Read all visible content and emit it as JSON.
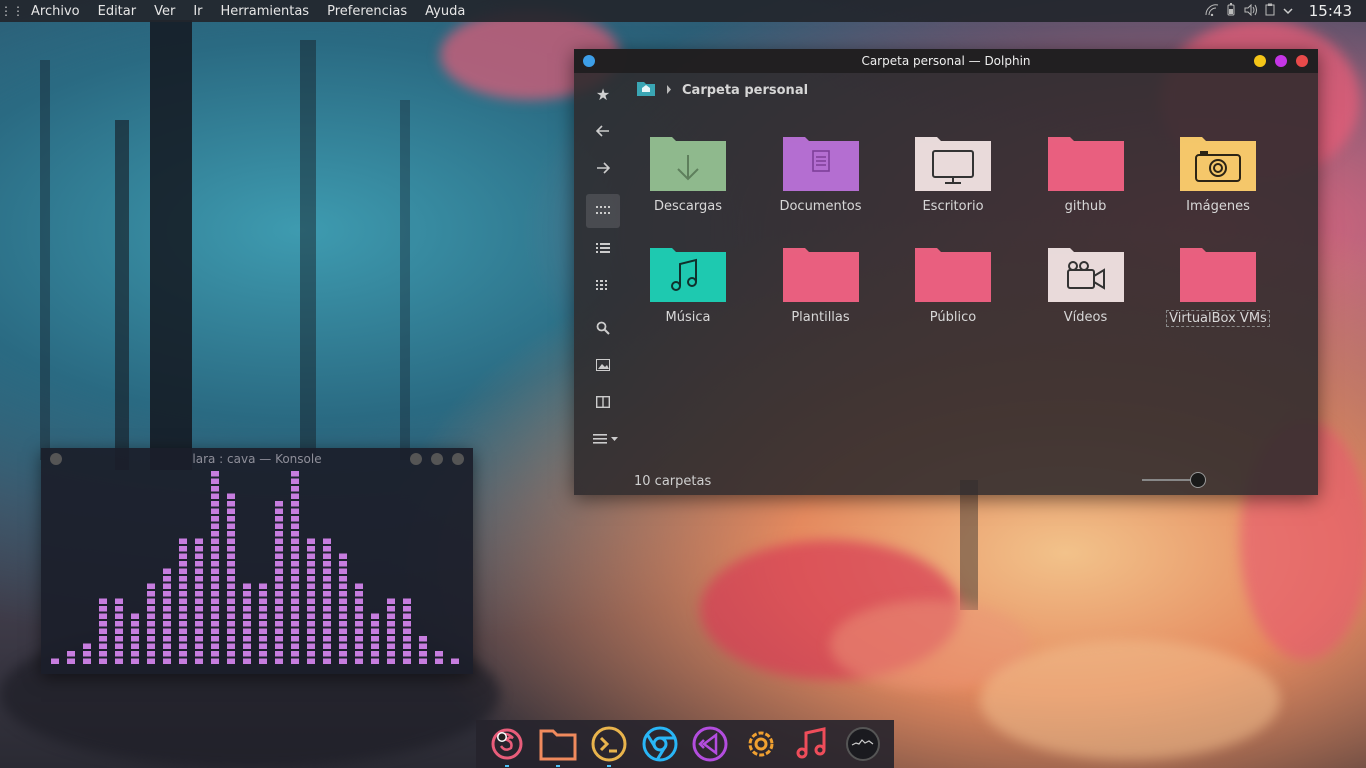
{
  "menubar": {
    "items": [
      "Archivo",
      "Editar",
      "Ver",
      "Ir",
      "Herramientas",
      "Preferencias",
      "Ayuda"
    ]
  },
  "tray": {
    "icons": [
      "wifi-icon",
      "battery-icon",
      "volume-icon",
      "clipboard-icon",
      "chevron-down-icon"
    ],
    "clock": "15:43"
  },
  "dolphin": {
    "title": "Carpeta personal — Dolphin",
    "breadcrumb": "Carpeta personal",
    "status": "10 carpetas",
    "title_dots": [
      "#f5c518",
      "#c535e6",
      "#e84a4a"
    ],
    "sidebar": [
      "star-icon",
      "back-icon",
      "forward-icon",
      "icons-view-icon",
      "details-view-icon",
      "compact-view-icon",
      "search-icon",
      "preview-icon",
      "split-icon",
      "menu-icon"
    ],
    "folders": [
      {
        "name": "Descargas",
        "color": "#8fb98d",
        "icon": "download-icon"
      },
      {
        "name": "Documentos",
        "color": "#b46ed0",
        "icon": "document-icon"
      },
      {
        "name": "Escritorio",
        "color": "#e8dada",
        "icon": "monitor-icon"
      },
      {
        "name": "github",
        "color": "#e8607f",
        "icon": "folder-icon"
      },
      {
        "name": "Imágenes",
        "color": "#f4c76a",
        "icon": "camera-icon"
      },
      {
        "name": "Música",
        "color": "#1ec9b0",
        "icon": "music-icon"
      },
      {
        "name": "Plantillas",
        "color": "#e8607f",
        "icon": "folder-icon"
      },
      {
        "name": "Público",
        "color": "#e8607f",
        "icon": "folder-icon"
      },
      {
        "name": "Vídeos",
        "color": "#e8dada",
        "icon": "video-icon"
      },
      {
        "name": "VirtualBox VMs",
        "color": "#e8607f",
        "icon": "folder-icon"
      }
    ]
  },
  "konsole": {
    "title": "lara : cava — Konsole",
    "bar_color": "#c77ddf",
    "levels": [
      1,
      2,
      3,
      9,
      9,
      7,
      11,
      13,
      17,
      17,
      30,
      23,
      11,
      11,
      22,
      30,
      17,
      17,
      15,
      11,
      7,
      9,
      9,
      4,
      2,
      1
    ]
  },
  "dock": {
    "apps": [
      "firefox-icon",
      "files-icon",
      "terminal-icon",
      "chrome-icon",
      "vscode-icon",
      "settings-icon",
      "music-player-icon",
      "system-monitor-icon"
    ]
  }
}
